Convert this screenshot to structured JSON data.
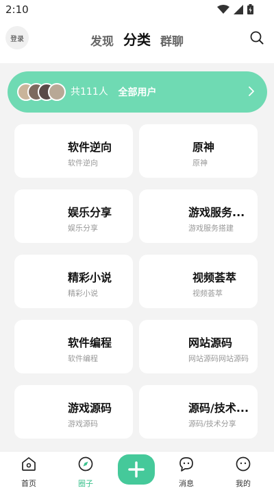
{
  "status_bar": {
    "time": "2:10"
  },
  "header": {
    "login_label": "登录",
    "tabs": [
      {
        "label": "发现"
      },
      {
        "label": "分类"
      },
      {
        "label": "群聊"
      }
    ]
  },
  "banner": {
    "count_text": "共111人",
    "title": "全部用户"
  },
  "categories": [
    {
      "title": "软件逆向",
      "subtitle": "软件逆向"
    },
    {
      "title": "原神",
      "subtitle": "原神"
    },
    {
      "title": "娱乐分享",
      "subtitle": "娱乐分享"
    },
    {
      "title": "游戏服务...",
      "subtitle": "游戏服务搭建"
    },
    {
      "title": "精彩小说",
      "subtitle": "精彩小说"
    },
    {
      "title": "视频荟萃",
      "subtitle": "视频荟萃"
    },
    {
      "title": "软件编程",
      "subtitle": "软件编程"
    },
    {
      "title": "网站源码",
      "subtitle": "网站源码网站源码"
    },
    {
      "title": "游戏源码",
      "subtitle": "游戏源码"
    },
    {
      "title": "源码/技术...",
      "subtitle": "源码/技术分享"
    }
  ],
  "bottom_nav": {
    "items": [
      {
        "label": "首页"
      },
      {
        "label": "圈子"
      },
      {
        "label": "消息"
      },
      {
        "label": "我的"
      }
    ]
  },
  "colors": {
    "accent": "#45c99a",
    "banner": "#6fdab3",
    "active_label": "#3cc28e"
  }
}
